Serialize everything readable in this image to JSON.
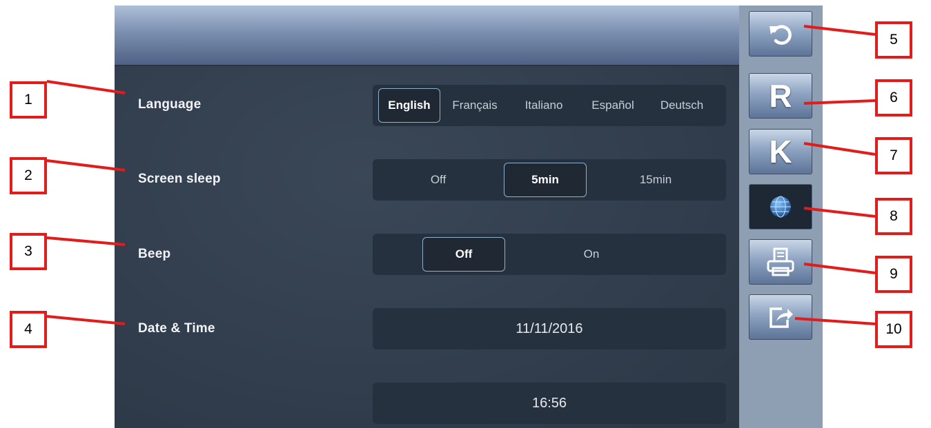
{
  "settings": {
    "language": {
      "label": "Language",
      "options": [
        "English",
        "Français",
        "Italiano",
        "Español",
        "Deutsch"
      ],
      "selected": "English"
    },
    "screen_sleep": {
      "label": "Screen sleep",
      "options": [
        "Off",
        "5min",
        "15min"
      ],
      "selected": "5min"
    },
    "beep": {
      "label": "Beep",
      "options": [
        "Off",
        "On"
      ],
      "selected": "Off"
    },
    "date_time": {
      "label": "Date & Time",
      "date": "11/11/2016",
      "time": "16:56"
    }
  },
  "sidebar": {
    "back_icon": "undo-arrow-icon",
    "r_label": "R",
    "k_label": "K",
    "globe_icon": "globe-icon",
    "print_icon": "printer-icon",
    "export_icon": "export-icon"
  },
  "callouts": [
    "1",
    "2",
    "3",
    "4",
    "5",
    "6",
    "7",
    "8",
    "9",
    "10"
  ],
  "colors": {
    "callout_red": "#e21b1b",
    "screen_bg": "#34404f",
    "panel_bg": "#263140",
    "selected_border": "#8fb1cf"
  }
}
